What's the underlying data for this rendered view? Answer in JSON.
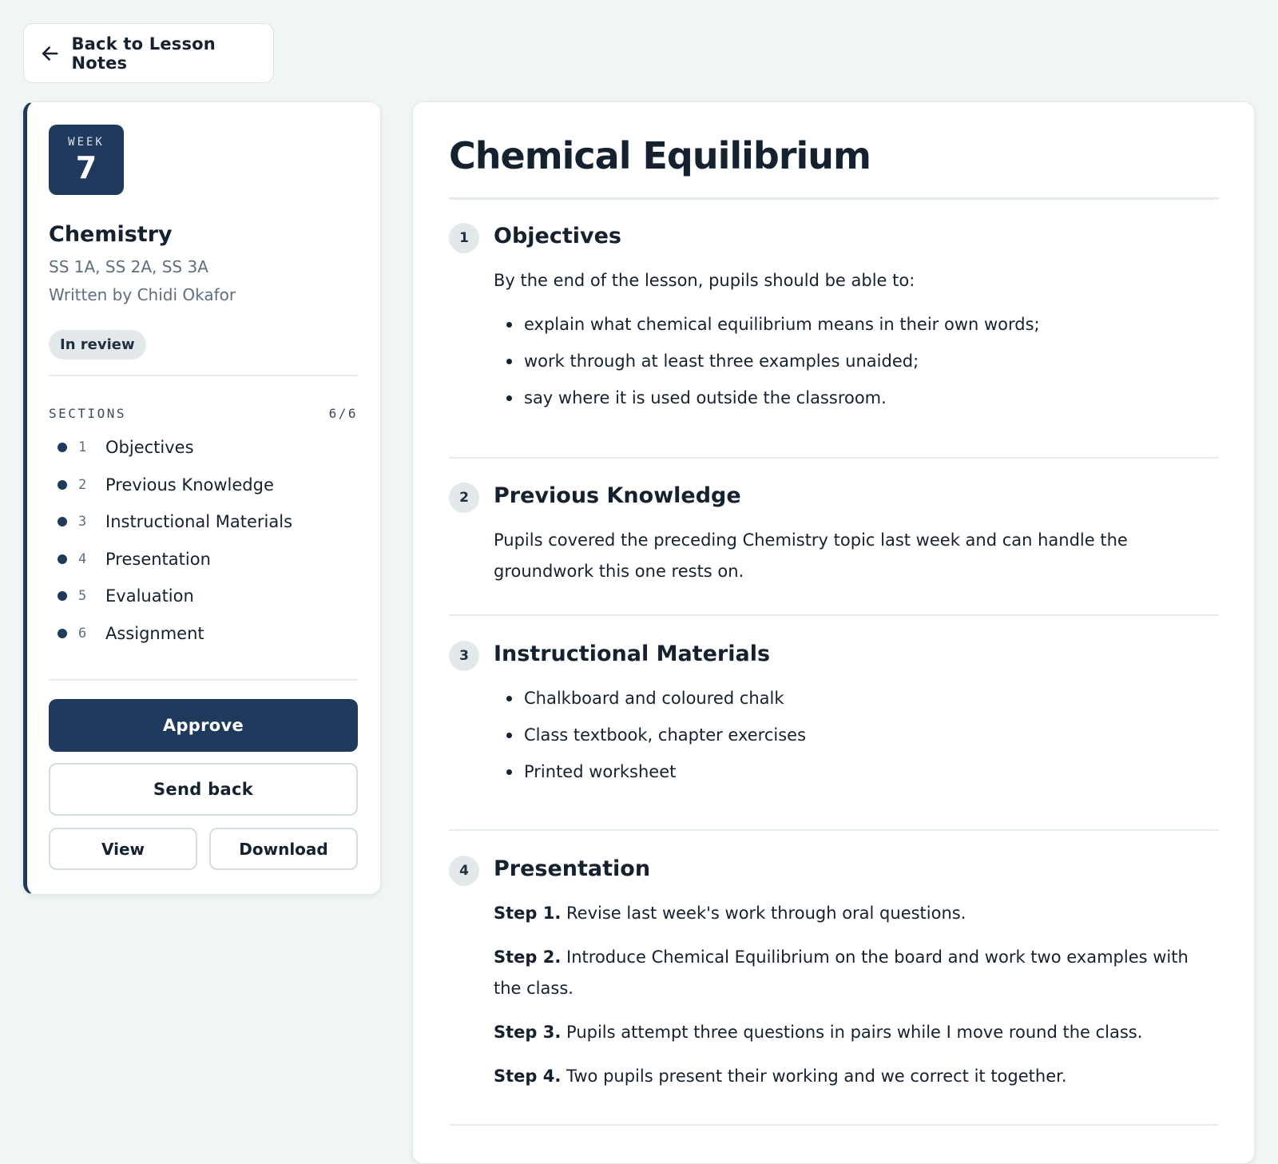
{
  "back_label": "Back to Lesson Notes",
  "sidebar": {
    "week_label": "WEEK",
    "week_number": "7",
    "subject": "Chemistry",
    "classes": "SS 1A, SS 2A, SS 3A",
    "author": "Written by Chidi Okafor",
    "status": "In review",
    "sections_label": "SECTIONS",
    "sections_count": "6/6",
    "sections": [
      {
        "n": "1",
        "label": "Objectives"
      },
      {
        "n": "2",
        "label": "Previous Knowledge"
      },
      {
        "n": "3",
        "label": "Instructional Materials"
      },
      {
        "n": "4",
        "label": "Presentation"
      },
      {
        "n": "5",
        "label": "Evaluation"
      },
      {
        "n": "6",
        "label": "Assignment"
      }
    ],
    "approve_label": "Approve",
    "send_back_label": "Send back",
    "view_label": "View",
    "download_label": "Download"
  },
  "main": {
    "title": "Chemical Equilibrium",
    "objectives": {
      "n": "1",
      "title": "Objectives",
      "intro": "By the end of the lesson, pupils should be able to:",
      "items": [
        "explain what chemical equilibrium means in their own words;",
        "work through at least three examples unaided;",
        "say where it is used outside the classroom."
      ]
    },
    "previous_knowledge": {
      "n": "2",
      "title": "Previous Knowledge",
      "text": "Pupils covered the preceding Chemistry topic last week and can handle the groundwork this one rests on."
    },
    "materials": {
      "n": "3",
      "title": "Instructional Materials",
      "items": [
        "Chalkboard and coloured chalk",
        "Class textbook, chapter exercises",
        "Printed worksheet"
      ]
    },
    "presentation": {
      "n": "4",
      "title": "Presentation",
      "steps": [
        {
          "label": "Step 1.",
          "text": "Revise last week's work through oral questions."
        },
        {
          "label": "Step 2.",
          "text": "Introduce Chemical Equilibrium on the board and work two examples with the class."
        },
        {
          "label": "Step 3.",
          "text": "Pupils attempt three questions in pairs while I move round the class."
        },
        {
          "label": "Step 4.",
          "text": "Two pupils present their working and we correct it together."
        }
      ]
    }
  }
}
